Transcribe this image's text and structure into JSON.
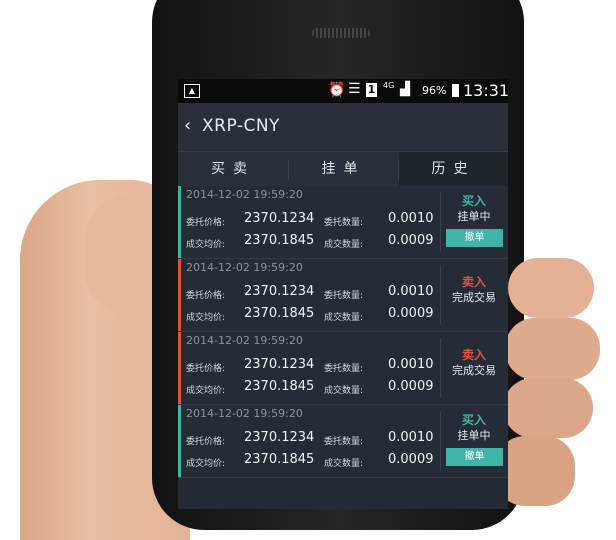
{
  "status_bar": {
    "battery_percent": "96%",
    "network": "4G",
    "sim": "1",
    "time": "13:31"
  },
  "header": {
    "title": "XRP-CNY"
  },
  "tabs": [
    {
      "label": "买卖",
      "active": false
    },
    {
      "label": "挂单",
      "active": false
    },
    {
      "label": "历史",
      "active": true
    }
  ],
  "orders": [
    {
      "datetime": "2014-12-02  19:59:20",
      "commission_price_label": "委托价格:",
      "commission_price": "2370.1234",
      "commission_amount_label": "委托数量:",
      "commission_amount": "0.0010",
      "deal_price_label": "成交均价:",
      "deal_price": "2370.1845",
      "deal_amount_label": "成交数量:",
      "deal_amount": "0.0009",
      "type": "买入",
      "type_color": "#3fb4a8",
      "status": "挂单中",
      "action": "撤单"
    },
    {
      "datetime": "2014-12-02  19:59:20",
      "commission_price_label": "委托价格:",
      "commission_price": "2370.1234",
      "commission_amount_label": "委托数量:",
      "commission_amount": "0.0010",
      "deal_price_label": "成交均价:",
      "deal_price": "2370.1845",
      "deal_amount_label": "成交数量:",
      "deal_amount": "0.0009",
      "type": "卖入",
      "type_color": "#e2533e",
      "status": "完成交易",
      "action": null
    },
    {
      "datetime": "2014-12-02  19:59:20",
      "commission_price_label": "委托价格:",
      "commission_price": "2370.1234",
      "commission_amount_label": "委托数量:",
      "commission_amount": "0.0010",
      "deal_price_label": "成交均价:",
      "deal_price": "2370.1845",
      "deal_amount_label": "成交数量:",
      "deal_amount": "0.0009",
      "type": "卖入",
      "type_color": "#e2533e",
      "status": "完成交易",
      "action": null
    },
    {
      "datetime": "2014-12-02  19:59:20",
      "commission_price_label": "委托价格:",
      "commission_price": "2370.1234",
      "commission_amount_label": "委托数量:",
      "commission_amount": "0.0010",
      "deal_price_label": "成交均价:",
      "deal_price": "2370.1845",
      "deal_amount_label": "成交数量:",
      "deal_amount": "0.0009",
      "type": "买入",
      "type_color": "#3fb4a8",
      "status": "挂单中",
      "action": "撤单"
    }
  ]
}
